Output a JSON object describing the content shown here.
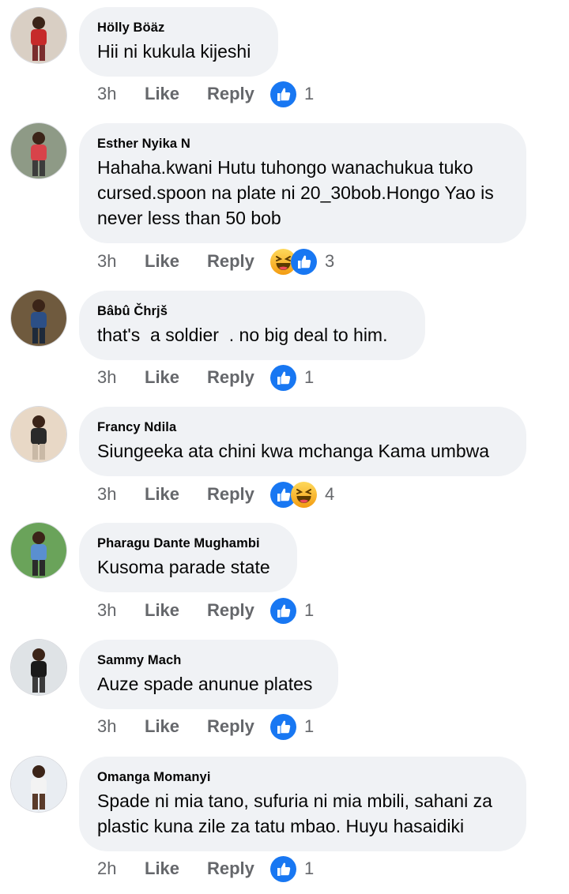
{
  "comments": [
    {
      "author": "Hölly Böäz",
      "text": "Hii ni kukula kijeshi",
      "time": "3h",
      "like": "Like",
      "reply": "Reply",
      "reactions": [
        "like-icon"
      ],
      "count": "1",
      "avatar": {
        "bg": "#d9cfc4",
        "shirt": "#c62a2a",
        "pants": "#7a2d2d"
      }
    },
    {
      "author": "Esther Nyika N",
      "text": "Hahaha.kwani Hutu tuhongo wanachukua tuko\ncursed.spoon na plate ni 20_30bob.Hongo Yao is\nnever less than 50 bob",
      "time": "3h",
      "like": "Like",
      "reply": "Reply",
      "reactions": [
        "haha-icon",
        "like-icon"
      ],
      "count": "3",
      "avatar": {
        "bg": "#8e9a86",
        "shirt": "#d8434a",
        "pants": "#3c3c3c"
      }
    },
    {
      "author": "Bâbû Čhrjš",
      "text": "that's  a soldier  . no big deal to him.",
      "time": "3h",
      "like": "Like",
      "reply": "Reply",
      "reactions": [
        "like-icon"
      ],
      "count": "1",
      "avatar": {
        "bg": "#6f5a3e",
        "shirt": "#2c4f86",
        "pants": "#1e2a3a"
      }
    },
    {
      "author": "Francy Ndila",
      "text": "Siungeeka ata chini kwa mchanga Kama umbwa",
      "time": "3h",
      "like": "Like",
      "reply": "Reply",
      "reactions": [
        "like-icon",
        "haha-icon"
      ],
      "count": "4",
      "avatar": {
        "bg": "#e8d8c6",
        "shirt": "#2a2a2a",
        "pants": "#c9b9a6"
      }
    },
    {
      "author": "Pharagu Dante Mughambi",
      "text": "Kusoma parade state",
      "time": "3h",
      "like": "Like",
      "reply": "Reply",
      "reactions": [
        "like-icon"
      ],
      "count": "1",
      "avatar": {
        "bg": "#6aa35a",
        "shirt": "#5a8fd0",
        "pants": "#2b2b2b"
      }
    },
    {
      "author": "Sammy Mach",
      "text": "Auze spade anunue plates",
      "time": "3h",
      "like": "Like",
      "reply": "Reply",
      "reactions": [
        "like-icon"
      ],
      "count": "1",
      "avatar": {
        "bg": "#dfe3e6",
        "shirt": "#1a1a1a",
        "pants": "#3b3b3b"
      }
    },
    {
      "author": "Omanga Momanyi",
      "text": "Spade ni mia tano, sufuria ni mia mbili, sahani za\nplastic kuna zile za tatu mbao. Huyu hasaidiki",
      "time": "2h",
      "like": "Like",
      "reply": "Reply",
      "reactions": [
        "like-icon"
      ],
      "count": "1",
      "avatar": {
        "bg": "#e9edf2",
        "shirt": "#f3f3f3",
        "pants": "#5a3b2a"
      }
    }
  ],
  "colors": {
    "bubble": "#f0f2f5",
    "meta_text": "#65676b",
    "like_blue": "#1877f2",
    "haha_yellow": "#f7b125"
  }
}
